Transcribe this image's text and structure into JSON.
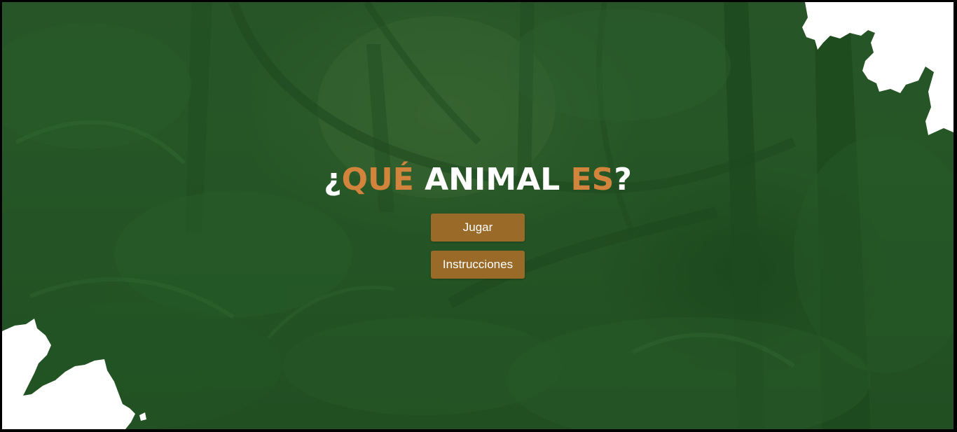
{
  "title": {
    "open_mark": "¿",
    "word1": "QUÉ",
    "word2": "ANIMAL",
    "word3": "ES",
    "close_mark": "?"
  },
  "menu": {
    "play_label": "Jugar",
    "instructions_label": "Instrucciones"
  },
  "colors": {
    "background": "#2a5a2a",
    "accent": "#d3843c",
    "title_text": "#ffffff",
    "button": "#9a6a28",
    "splash": "#ffffff"
  },
  "icons": {
    "corner_decor": "white-paint-splash"
  }
}
